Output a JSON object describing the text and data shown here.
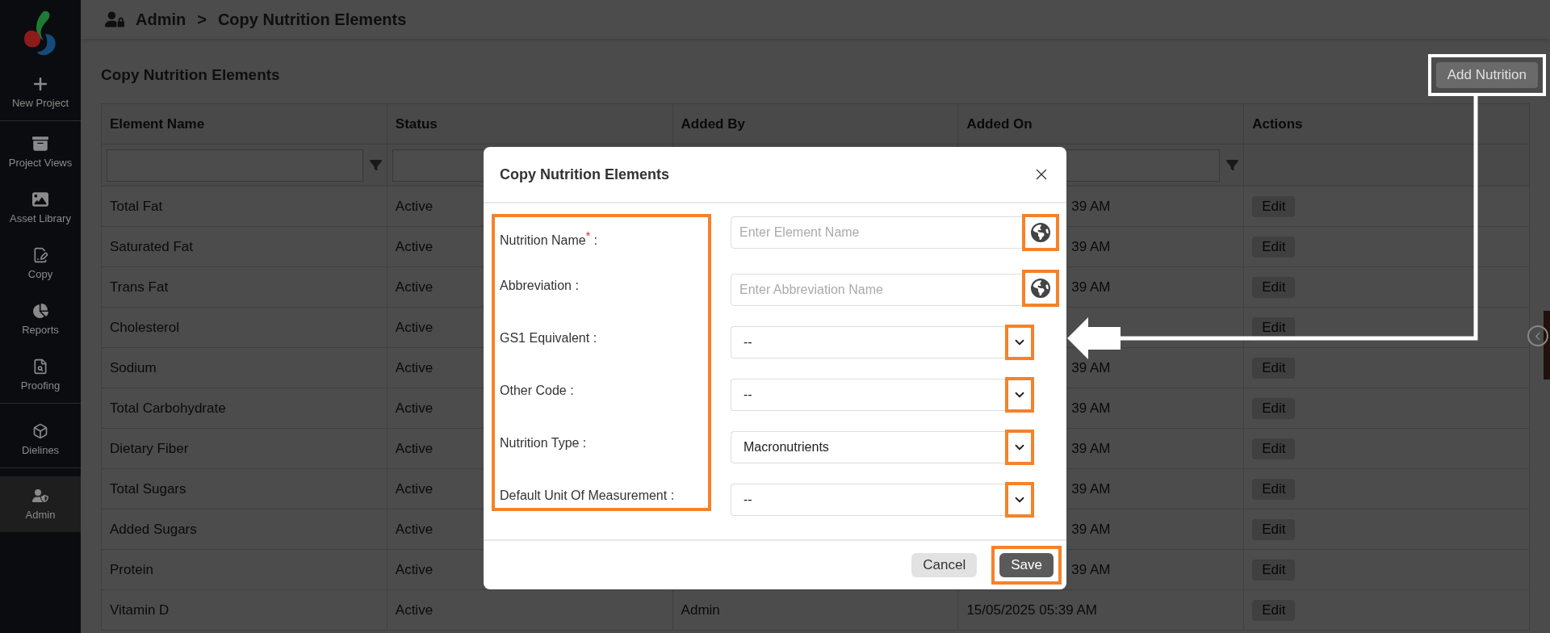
{
  "sidebar": {
    "items": [
      {
        "label": "New Project",
        "selected": false,
        "divider_after": true
      },
      {
        "label": "Project Views",
        "selected": false,
        "divider_after": false
      },
      {
        "label": "Asset Library",
        "selected": false,
        "divider_after": false
      },
      {
        "label": "Copy",
        "selected": false,
        "divider_after": false
      },
      {
        "label": "Reports",
        "selected": false,
        "divider_after": false
      },
      {
        "label": "Proofing",
        "selected": false,
        "divider_after": true
      },
      {
        "label": "Dielines",
        "selected": false,
        "divider_after": true
      },
      {
        "label": "Admin",
        "selected": true,
        "divider_after": false
      }
    ]
  },
  "breadcrumb": {
    "items": [
      "Admin",
      "Copy Nutrition Elements"
    ],
    "separator": ">"
  },
  "page_title": "Copy Nutrition Elements",
  "add_button": {
    "label": "Add Nutrition",
    "highlighted": true
  },
  "table": {
    "columns": [
      {
        "label": "Element Name",
        "filter": true,
        "filter_button": true
      },
      {
        "label": "Status",
        "filter": true
      },
      {
        "label": "Added By"
      },
      {
        "label": "Added On",
        "filter": true,
        "filter_button": true
      },
      {
        "label": "Actions",
        "filter": false
      }
    ],
    "rows": [
      {
        "element_name": "Total Fat",
        "status": "Active",
        "added_on": "39 AM",
        "under_dialog": true,
        "action": "Edit"
      },
      {
        "element_name": "Saturated Fat",
        "status": "Active",
        "added_on": "39 AM",
        "under_dialog": true,
        "action": "Edit"
      },
      {
        "element_name": "Trans Fat",
        "status": "Active",
        "added_on": "39 AM",
        "under_dialog": true,
        "action": "Edit"
      },
      {
        "element_name": "Cholesterol",
        "status": "Active",
        "under_dialog": true,
        "action": "Edit"
      },
      {
        "element_name": "Sodium",
        "status": "Active",
        "added_on": "39 AM",
        "under_dialog": true,
        "action": "Edit"
      },
      {
        "element_name": "Total Carbohydrate",
        "status": "Active",
        "added_on": "39 AM",
        "under_dialog": true,
        "action": "Edit"
      },
      {
        "element_name": "Dietary Fiber",
        "status": "Active",
        "added_on": "39 AM",
        "under_dialog": true,
        "action": "Edit"
      },
      {
        "element_name": "Total Sugars",
        "status": "Active",
        "added_on": "39 AM",
        "under_dialog": true,
        "action": "Edit"
      },
      {
        "element_name": "Added Sugars",
        "status": "Active",
        "added_on": "39 AM",
        "under_dialog": true,
        "action": "Edit"
      },
      {
        "element_name": "Protein",
        "status": "Active",
        "added_on": "39 AM",
        "under_dialog": true,
        "action": "Edit"
      },
      {
        "element_name": "Vitamin D",
        "status": "Active",
        "added_by": "Admin",
        "added_on": "15/05/2025 05:39 AM",
        "under_dialog": false,
        "action": "Edit"
      }
    ]
  },
  "dialog": {
    "title": "Copy Nutrition Elements",
    "labels_highlighted": true,
    "fields": [
      {
        "kind": "text",
        "label": "Nutrition Name$^{*}$ :",
        "placeholder": "Enter Element Name",
        "icon_highlighted": true
      },
      {
        "kind": "text",
        "label": "Abbreviation :",
        "placeholder": "Enter Abbreviation Name",
        "icon_highlighted": true
      },
      {
        "kind": "select",
        "label": "GS1 Equivalent :",
        "value": "--",
        "icon_highlighted": true
      },
      {
        "kind": "select",
        "label": "Other Code :",
        "value": "--",
        "icon_highlighted": true
      },
      {
        "kind": "select",
        "label": "Nutrition Type :",
        "value": "Macronutrients",
        "icon_highlighted": true
      },
      {
        "kind": "select",
        "label": "Default Unit Of Measurement :",
        "value": "--",
        "icon_highlighted": true
      }
    ],
    "buttons": [
      {
        "label": "Cancel",
        "kind": "secondary",
        "highlighted": false
      },
      {
        "label": "Save",
        "kind": "primary",
        "highlighted": true
      }
    ]
  }
}
